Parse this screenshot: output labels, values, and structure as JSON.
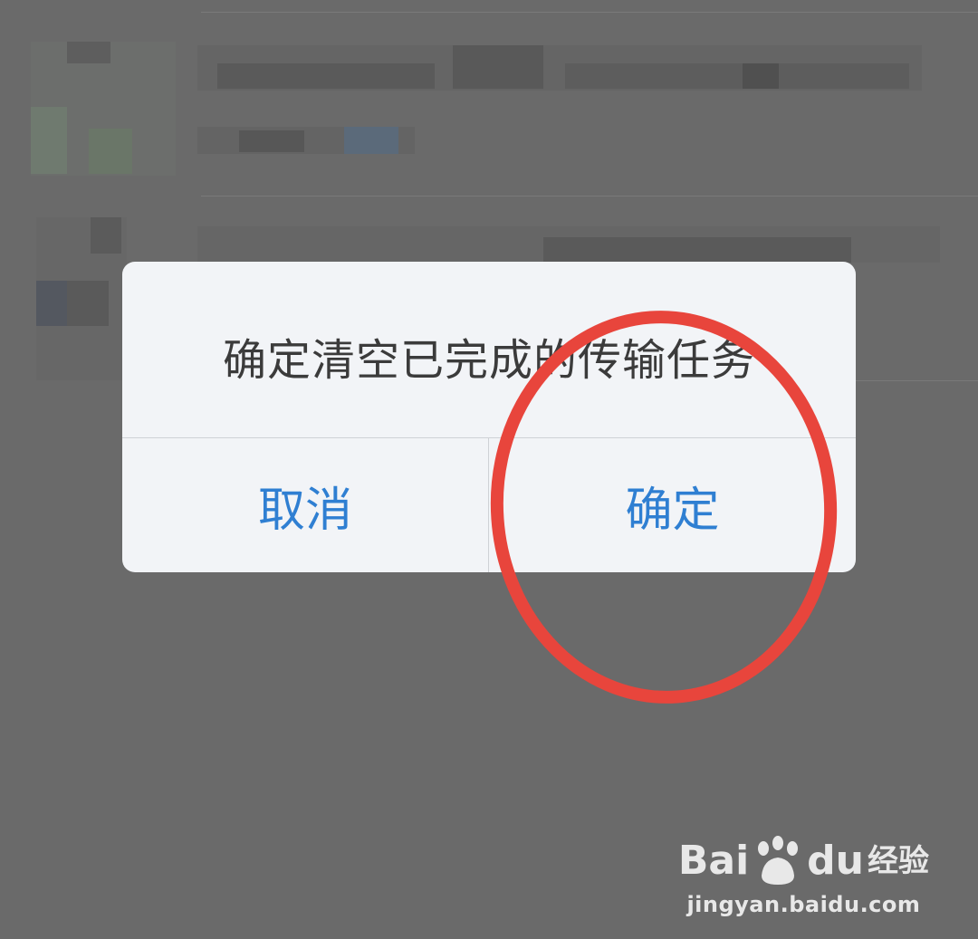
{
  "dialog": {
    "message": "确定清空已完成的传输任务",
    "cancel_label": "取消",
    "confirm_label": "确定"
  },
  "watermark": {
    "brand_left": "Bai",
    "brand_right": "du",
    "brand_suffix": "经验",
    "url": "jingyan.baidu.com"
  },
  "colors": {
    "overlay": "#6a6a6a",
    "dialog_bg": "#f2f4f7",
    "button_text": "#2f7fd2",
    "annotation": "#e8453c"
  },
  "icons": {
    "watermark_logo": "baidu-paw-icon"
  }
}
